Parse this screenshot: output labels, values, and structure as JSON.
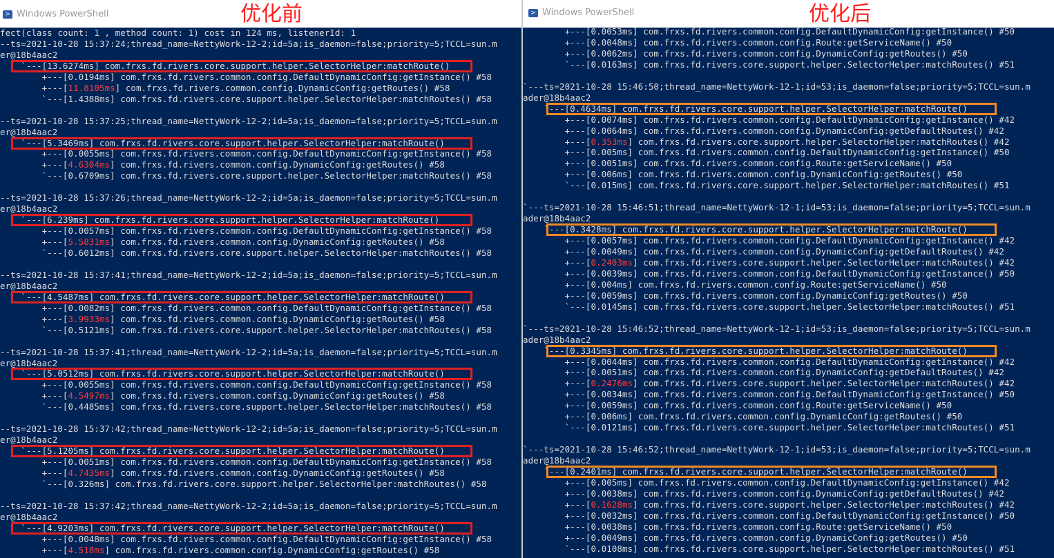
{
  "left": {
    "window_title": "Windows PowerShell",
    "heading": "优化前",
    "lines": [
      "fect(class count: 1 , method count: 1) cost in 124 ms, listenerId: 1",
      "--ts=2021-10-28 15:37:24;thread_name=NettyWork-12-2;id=5a;is_daemon=false;priority=5;TCCL=sun.m",
      "er@18b4aac2",
      "    `---[13.6274ms] com.frxs.fd.rivers.core.support.helper.SelectorHelper:matchRoute()",
      "        +---[0.0194ms] com.frxs.fd.rivers.common.config.DefaultDynamicConfig:getInstance() #58",
      "        +---[11.8105ms] com.frxs.fd.rivers.common.config.DynamicConfig:getRoutes() #58",
      "        `---[1.4388ms] com.frxs.fd.rivers.core.support.helper.SelectorHelper:matchRoutes() #58",
      "",
      "--ts=2021-10-28 15:37:25;thread_name=NettyWork-12-2;id=5a;is_daemon=false;priority=5;TCCL=sun.m",
      "er@18b4aac2",
      "    `---[5.3469ms] com.frxs.fd.rivers.core.support.helper.SelectorHelper:matchRoute()",
      "        +---[0.0055ms] com.frxs.fd.rivers.common.config.DefaultDynamicConfig:getInstance() #58",
      "        +---[4.6304ms] com.frxs.fd.rivers.common.config.DynamicConfig:getRoutes() #58",
      "        `---[0.6709ms] com.frxs.fd.rivers.core.support.helper.SelectorHelper:matchRoutes() #58",
      "",
      "--ts=2021-10-28 15:37:26;thread_name=NettyWork-12-2;id=5a;is_daemon=false;priority=5;TCCL=sun.m",
      "er@18b4aac2",
      "    `---[6.239ms] com.frxs.fd.rivers.core.support.helper.SelectorHelper:matchRoute()",
      "        +---[0.0057ms] com.frxs.fd.rivers.common.config.DefaultDynamicConfig:getInstance() #58",
      "        +---[5.5831ms] com.frxs.fd.rivers.common.config.DynamicConfig:getRoutes() #58",
      "        `---[0.6012ms] com.frxs.fd.rivers.core.support.helper.SelectorHelper:matchRoutes() #58",
      "",
      "--ts=2021-10-28 15:37:41;thread_name=NettyWork-12-2;id=5a;is_daemon=false;priority=5;TCCL=sun.m",
      "er@18b4aac2",
      "    `---[4.5487ms] com.frxs.fd.rivers.core.support.helper.SelectorHelper:matchRoute()",
      "        +---[0.0082ms] com.frxs.fd.rivers.common.config.DefaultDynamicConfig:getInstance() #58",
      "        +---[3.9933ms] com.frxs.fd.rivers.common.config.DynamicConfig:getRoutes() #58",
      "        `---[0.5121ms] com.frxs.fd.rivers.core.support.helper.SelectorHelper:matchRoutes() #58",
      "",
      "--ts=2021-10-28 15:37:41;thread_name=NettyWork-12-2;id=5a;is_daemon=false;priority=5;TCCL=sun.m",
      "er@18b4aac2",
      "    `---[5.0512ms] com.frxs.fd.rivers.core.support.helper.SelectorHelper:matchRoute()",
      "        +---[0.0055ms] com.frxs.fd.rivers.common.config.DefaultDynamicConfig:getInstance() #58",
      "        +---[4.5497ms] com.frxs.fd.rivers.common.config.DynamicConfig:getRoutes() #58",
      "        `---[0.4485ms] com.frxs.fd.rivers.core.support.helper.SelectorHelper:matchRoutes() #58",
      "",
      "--ts=2021-10-28 15:37:42;thread_name=NettyWork-12-2;id=5a;is_daemon=false;priority=5;TCCL=sun.m",
      "er@18b4aac2",
      "    `---[5.1205ms] com.frxs.fd.rivers.core.support.helper.SelectorHelper:matchRoute()",
      "        +---[0.0051ms] com.frxs.fd.rivers.common.config.DefaultDynamicConfig:getInstance() #58",
      "        +---[4.7435ms] com.frxs.fd.rivers.common.config.DynamicConfig:getRoutes() #58",
      "        `---[0.326ms] com.frxs.fd.rivers.core.support.helper.SelectorHelper:matchRoutes() #58",
      "",
      "--ts=2021-10-28 15:37:42;thread_name=NettyWork-12-2;id=5a;is_daemon=false;priority=5;TCCL=sun.m",
      "er@18b4aac2",
      "    `---[4.9203ms] com.frxs.fd.rivers.core.support.helper.SelectorHelper:matchRoute()",
      "        +---[0.0048ms] com.frxs.fd.rivers.common.config.DefaultDynamicConfig:getInstance() #58",
      "        +---[4.518ms] com.frxs.fd.rivers.common.config.DynamicConfig:getRoutes() #58"
    ]
  },
  "right": {
    "window_title": "Windows PowerShell",
    "heading": "优化后",
    "lines": [
      "        +---[0.0053ms] com.frxs.fd.rivers.common.config.DefaultDynamicConfig:getInstance() #50",
      "        +---[0.0048ms] com.frxs.fd.rivers.common.config.Route:getServiceName() #50",
      "        +---[0.0062ms] com.frxs.fd.rivers.common.config.DynamicConfig:getRoutes() #50",
      "        `---[0.0163ms] com.frxs.fd.rivers.core.support.helper.SelectorHelper:matchRoutes() #51",
      "",
      "`---ts=2021-10-28 15:46:50;thread_name=NettyWork-12-1;id=53;is_daemon=false;priority=5;TCCL=sun.m",
      "ader@18b4aac2",
      "    `---[0.4634ms] com.frxs.fd.rivers.core.support.helper.SelectorHelper:matchRoute()",
      "        +---[0.0074ms] com.frxs.fd.rivers.common.config.DefaultDynamicConfig:getInstance() #42",
      "        +---[0.0064ms] com.frxs.fd.rivers.common.config.DynamicConfig:getDefaultRoutes() #42",
      "        +---[0.353ms] com.frxs.fd.rivers.core.support.helper.SelectorHelper:matchRoutes() #42",
      "        +---[0.005ms] com.frxs.fd.rivers.common.config.DefaultDynamicConfig:getInstance() #50",
      "        +---[0.0051ms] com.frxs.fd.rivers.common.config.Route:getServiceName() #50",
      "        +---[0.006ms] com.frxs.fd.rivers.common.config.DynamicConfig:getRoutes() #50",
      "        `---[0.015ms] com.frxs.fd.rivers.core.support.helper.SelectorHelper:matchRoutes() #51",
      "",
      "`---ts=2021-10-28 15:46:51;thread_name=NettyWork-12-1;id=53;is_daemon=false;priority=5;TCCL=sun.m",
      "ader@18b4aac2",
      "    `---[0.3428ms] com.frxs.fd.rivers.core.support.helper.SelectorHelper:matchRoute()",
      "        +---[0.0057ms] com.frxs.fd.rivers.common.config.DefaultDynamicConfig:getInstance() #42",
      "        +---[0.0049ms] com.frxs.fd.rivers.common.config.DynamicConfig:getDefaultRoutes() #42",
      "        +---[0.2403ms] com.frxs.fd.rivers.core.support.helper.SelectorHelper:matchRoutes() #42",
      "        +---[0.0039ms] com.frxs.fd.rivers.common.config.DefaultDynamicConfig:getInstance() #50",
      "        +---[0.004ms] com.frxs.fd.rivers.common.config.Route:getServiceName() #50",
      "        +---[0.0059ms] com.frxs.fd.rivers.common.config.DynamicConfig:getRoutes() #50",
      "        `---[0.0145ms] com.frxs.fd.rivers.core.support.helper.SelectorHelper:matchRoutes() #51",
      "",
      "`---ts=2021-10-28 15:46:52;thread_name=NettyWork-12-1;id=53;is_daemon=false;priority=5;TCCL=sun.m",
      "ader@18b4aac2",
      "    `---[0.3345ms] com.frxs.fd.rivers.core.support.helper.SelectorHelper:matchRoute()",
      "        +---[0.0044ms] com.frxs.fd.rivers.common.config.DefaultDynamicConfig:getInstance() #42",
      "        +---[0.0051ms] com.frxs.fd.rivers.common.config.DynamicConfig:getDefaultRoutes() #42",
      "        +---[0.2476ms] com.frxs.fd.rivers.core.support.helper.SelectorHelper:matchRoutes() #42",
      "        +---[0.0034ms] com.frxs.fd.rivers.common.config.DefaultDynamicConfig:getInstance() #50",
      "        +---[0.0059ms] com.frxs.fd.rivers.common.config.Route:getServiceName() #50",
      "        +---[0.006ms] com.frxs.fd.rivers.common.config.DynamicConfig:getRoutes() #50",
      "        `---[0.0121ms] com.frxs.fd.rivers.core.support.helper.SelectorHelper:matchRoutes() #51",
      "",
      "`---ts=2021-10-28 15:46:52;thread_name=NettyWork-12-1;id=53;is_daemon=false;priority=5;TCCL=sun.m",
      "ader@18b4aac2",
      "    `---[0.2401ms] com.frxs.fd.rivers.core.support.helper.SelectorHelper:matchRoute()",
      "        +---[0.005ms] com.frxs.fd.rivers.common.config.DefaultDynamicConfig:getInstance() #42",
      "        +---[0.0038ms] com.frxs.fd.rivers.common.config.DynamicConfig:getDefaultRoutes() #42",
      "        +---[0.1628ms] com.frxs.fd.rivers.core.support.helper.SelectorHelper:matchRoutes() #42",
      "        +---[0.0032ms] com.frxs.fd.rivers.common.config.DefaultDynamicConfig:getInstance() #50",
      "        +---[0.0038ms] com.frxs.fd.rivers.common.config.Route:getServiceName() #50",
      "        +---[0.0049ms] com.frxs.fd.rivers.common.config.DynamicConfig:getRoutes() #50",
      "        `---[0.0108ms] com.frxs.fd.rivers.core.support.helper.SelectorHelper:matchRoutes() #51"
    ]
  },
  "colors": {
    "console_bg": "#012456",
    "console_text": "#dcdcdc",
    "slow_timing": "#ff3b3b",
    "highlight_before": "#e02020",
    "highlight_after": "#f08a24",
    "heading": "#ff2020"
  },
  "icons": {
    "window_icon": "powershell-icon"
  }
}
